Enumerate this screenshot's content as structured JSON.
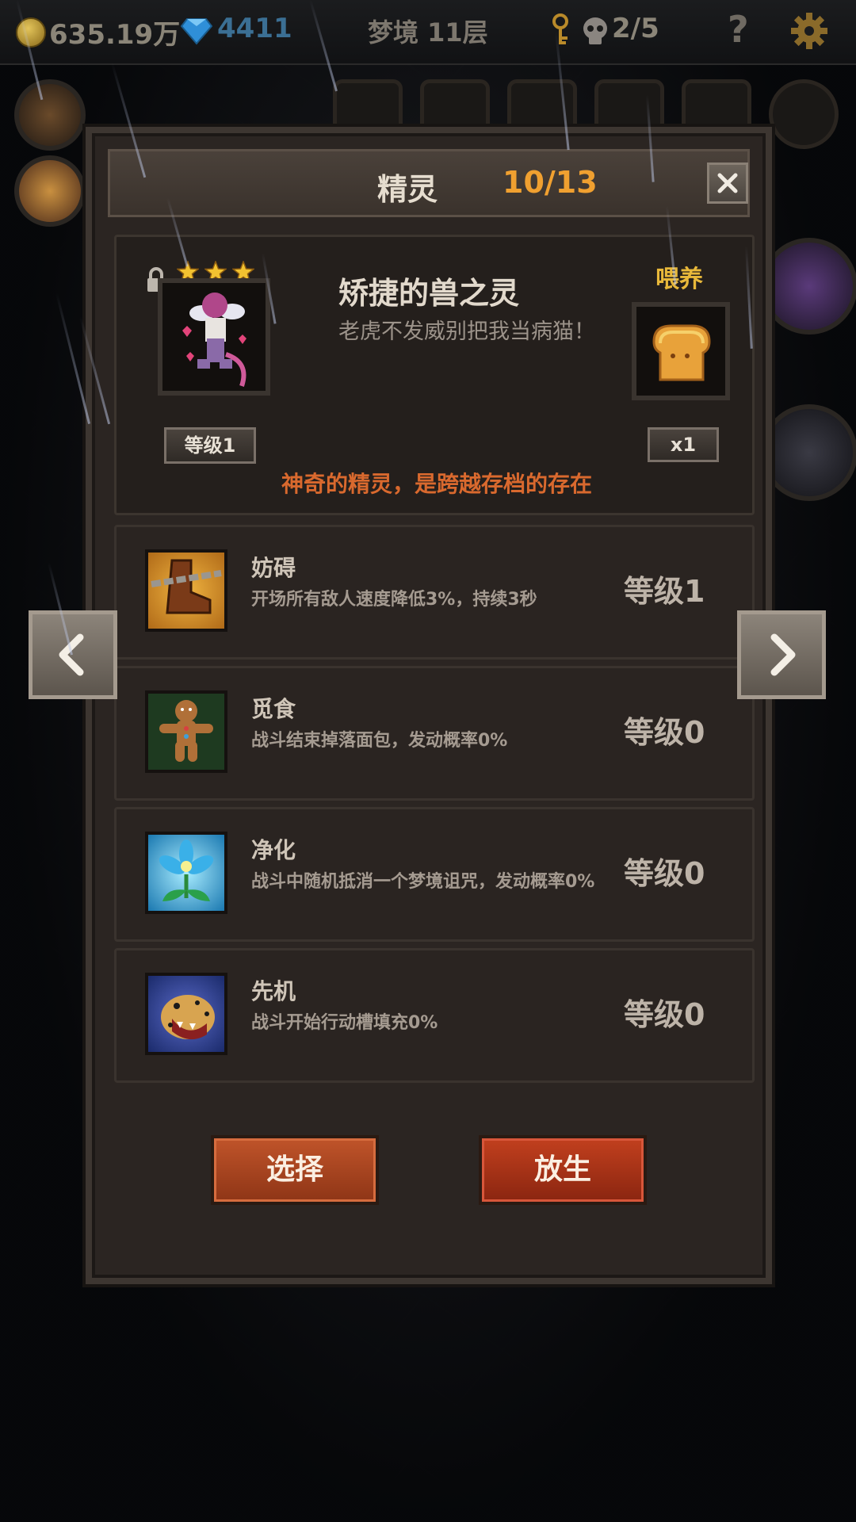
{
  "top_bar": {
    "gold": "635.19万",
    "gems": "4411",
    "floor": "梦境 11层",
    "skulls": "2/5",
    "help": "?"
  },
  "dialog": {
    "title": "精灵",
    "count": "10/13",
    "close_label": "✕",
    "spirit": {
      "stars": 3,
      "name": "矫捷的兽之灵",
      "desc": "老虎不发威别把我当病猫！",
      "level": "等级1",
      "feed_label": "喂养",
      "feed_count": "x1",
      "note": "神奇的精灵，是跨越存档的存在"
    },
    "skills": [
      {
        "name": "妨碍",
        "desc": "开场所有敌人速度降低3%，持续3秒",
        "level": "等级1",
        "icon": "chained-boot-icon"
      },
      {
        "name": "觅食",
        "desc": "战斗结束掉落面包，发动概率0%",
        "level": "等级0",
        "icon": "gingerbread-icon"
      },
      {
        "name": "净化",
        "desc": "战斗中随机抵消一个梦境诅咒，发动概率0%",
        "level": "等级0",
        "icon": "blue-flower-icon"
      },
      {
        "name": "先机",
        "desc": "战斗开始行动槽填充0%",
        "level": "等级0",
        "icon": "leopard-icon"
      }
    ],
    "buttons": {
      "select": "选择",
      "release": "放生"
    }
  },
  "colors": {
    "accent_orange": "#f0a030",
    "note_orange": "#d9692e",
    "feed_gold": "#e8b83a",
    "button_red": "#c0542a"
  }
}
